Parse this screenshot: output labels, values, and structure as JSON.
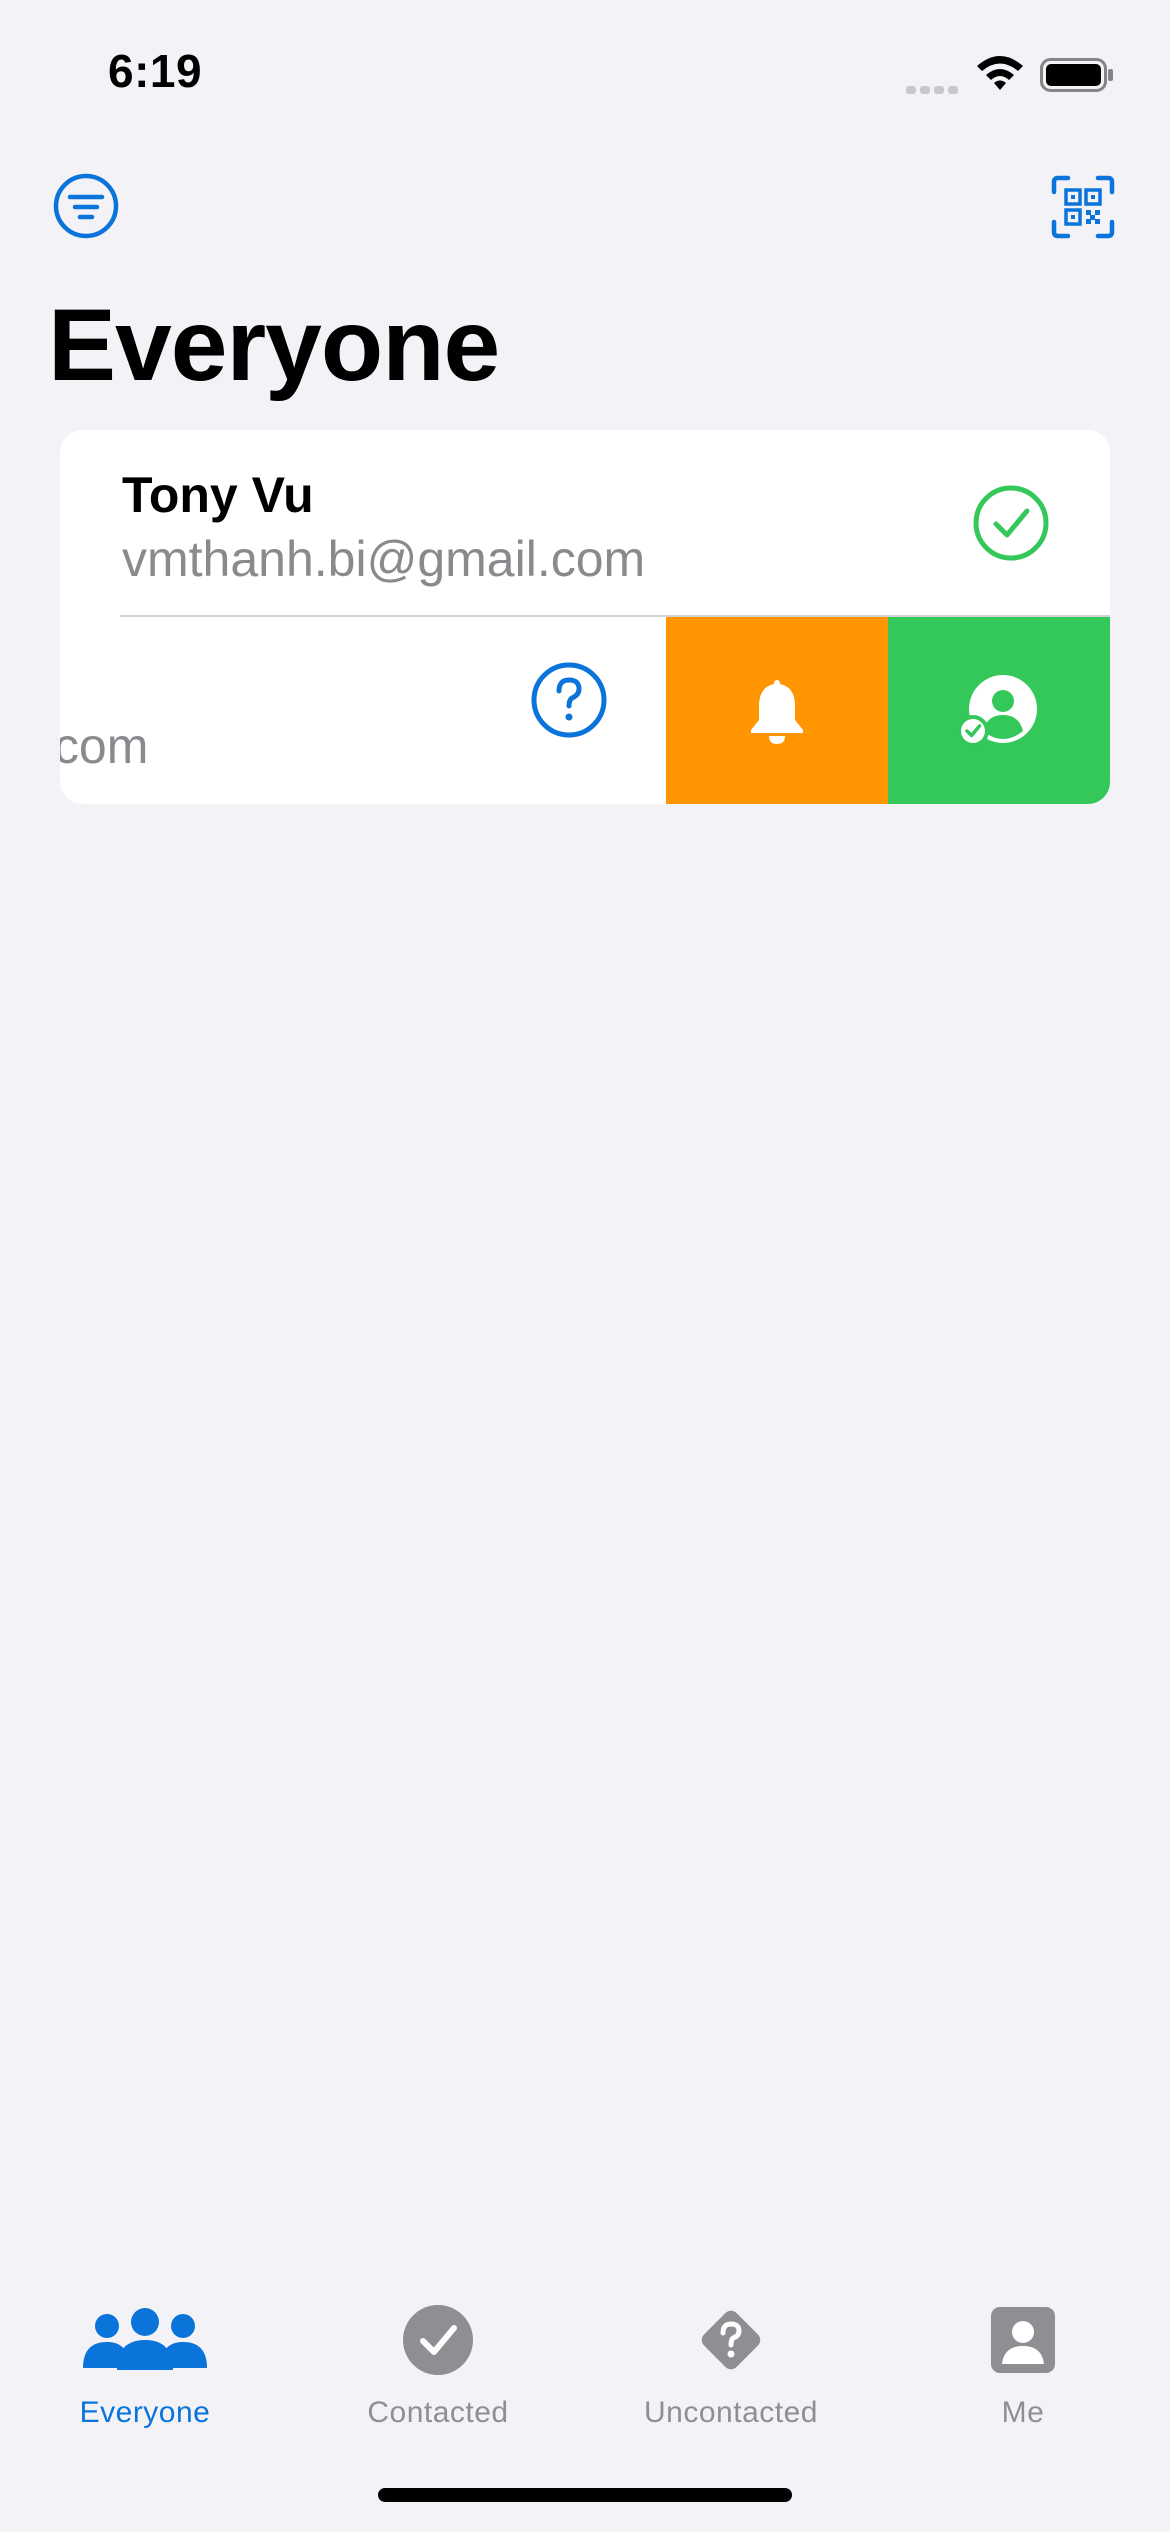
{
  "status_bar": {
    "time": "6:19"
  },
  "colors": {
    "accent": "#0A74DA",
    "orange_action": "#FF9500",
    "green_action": "#34C759",
    "secondary_text": "#8A8A8E",
    "tab_inactive": "#8E8E93",
    "background": "#F2F2F7"
  },
  "nav": {
    "filter_icon": "filter-circle-icon",
    "qr_icon": "qr-code-scan-icon"
  },
  "page_title": "Everyone",
  "people": [
    {
      "name": "Tony Vu",
      "email": "vmthanh.bi@gmail.com",
      "status_icon": "checkmark-circle-icon"
    },
    {
      "name": "",
      "email": "ail.com",
      "status_icon": "question-circle-icon",
      "swipe_actions": [
        {
          "icon": "bell-icon",
          "color": "#FF9500"
        },
        {
          "icon": "person-checkmark-icon",
          "color": "#34C759"
        }
      ]
    }
  ],
  "tabs": [
    {
      "label": "Everyone",
      "icon": "people-icon",
      "active": true
    },
    {
      "label": "Contacted",
      "icon": "checkmark-circle-fill-icon",
      "active": false
    },
    {
      "label": "Uncontacted",
      "icon": "question-diamond-icon",
      "active": false
    },
    {
      "label": "Me",
      "icon": "person-square-icon",
      "active": false
    }
  ]
}
